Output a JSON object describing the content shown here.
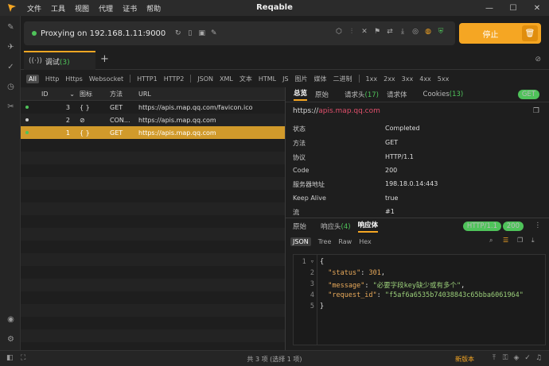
{
  "app": {
    "title": "Reqable"
  },
  "menu": [
    "文件",
    "工具",
    "视图",
    "代理",
    "证书",
    "帮助"
  ],
  "toolbar": {
    "proxy_text": "Proxying on 192.168.1.11:9000",
    "stop_label": "停止"
  },
  "tabs": {
    "active_label": "调试",
    "active_count": "(3)"
  },
  "filters": [
    "All",
    "Http",
    "Https",
    "Websocket",
    "HTTP1",
    "HTTP2",
    "JSON",
    "XML",
    "文本",
    "HTML",
    "JS",
    "图片",
    "媒体",
    "二进制",
    "1xx",
    "2xx",
    "3xx",
    "4xx",
    "5xx"
  ],
  "table": {
    "headers": {
      "id": "ID",
      "icon": "图标",
      "method": "方法",
      "url": "URL"
    },
    "rows": [
      {
        "id": "3",
        "icon": "{ }",
        "method": "GET",
        "url": "https://apis.map.qq.com/favicon.ico",
        "dot": "#4fc35a"
      },
      {
        "id": "2",
        "icon": "🔗",
        "method": "CON...",
        "url": "https://apis.map.qq.com",
        "dot": "#cccccc"
      },
      {
        "id": "1",
        "icon": "{ }",
        "method": "GET",
        "url": "https://apis.map.qq.com",
        "dot": "#4fc35a"
      }
    ]
  },
  "detail": {
    "tabs": {
      "overview": "总览",
      "raw": "原始",
      "req_headers": "请求头",
      "req_headers_count": "(17)",
      "req_body": "请求体",
      "cookies": "Cookies",
      "cookies_count": "(13)"
    },
    "method_pill": "GET",
    "url_scheme": "https://",
    "url_host": "apis.map.qq.com",
    "fields": [
      {
        "k": "状态",
        "v": "Completed"
      },
      {
        "k": "方法",
        "v": "GET"
      },
      {
        "k": "协议",
        "v": "HTTP/1.1"
      },
      {
        "k": "Code",
        "v": "200"
      },
      {
        "k": "服务器地址",
        "v": "198.18.0.14:443"
      },
      {
        "k": "Keep Alive",
        "v": "true"
      },
      {
        "k": "流",
        "v": "#1"
      }
    ]
  },
  "response": {
    "tabs": {
      "raw": "原始",
      "headers": "响应头",
      "headers_count": "(4)",
      "body": "响应体"
    },
    "proto_pill": "HTTP/1.1",
    "code_pill": "200",
    "formats": [
      "JSON",
      "Tree",
      "Raw",
      "Hex"
    ],
    "code": {
      "l1": "{",
      "l2_key": "\"status\"",
      "l2_val": "301",
      "l3_key": "\"message\"",
      "l3_val": "\"必要字段key缺少或有多个\"",
      "l4_key": "\"request_id\"",
      "l4_val": "\"f5af6a6535b74038843c65bba6061964\"",
      "l5": "}"
    }
  },
  "status": {
    "center": "共 3 项 (选择 1 项)",
    "new_version": "新版本"
  }
}
